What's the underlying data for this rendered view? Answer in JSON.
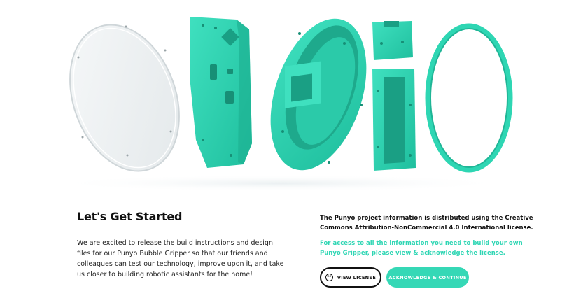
{
  "hero": {
    "image_alt": "Exploded view of Punyo Bubble Gripper parts",
    "part_color": "#2ed6b3",
    "shadow_color": "#1fb596"
  },
  "main": {
    "title": "Let's Get Started",
    "intro": "We are excited to release the build instructions and design files for our Punyo Bubble Gripper so that our friends and colleagues can test our technology, improve upon it, and take us closer to building robotic assistants for the home!"
  },
  "license_panel": {
    "notice": "The Punyo project information is distributed using the Creative Commons Attribution-NonCommercial 4.0 International license.",
    "access_text": "For access to all the information you need to build your own Punyo Gripper, please view & acknowledge the license.",
    "view_button": {
      "label": "VIEW LICENSE",
      "icon": "cc-icon",
      "icon_text": "cc"
    },
    "ack_button": {
      "label": "ACKNOWLEDGE & CONTINUE"
    }
  },
  "colors": {
    "accent": "#35d8b6",
    "text_dark": "#111111"
  }
}
